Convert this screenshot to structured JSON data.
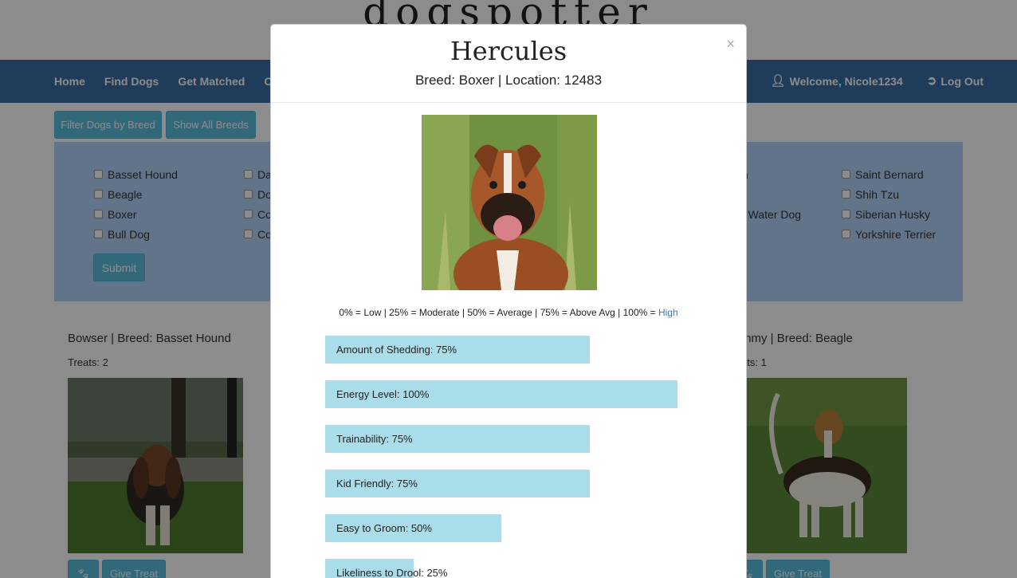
{
  "site": {
    "logo": "dogspotter"
  },
  "nav": {
    "left": [
      "Home",
      "Find Dogs",
      "Get Matched",
      "C"
    ],
    "welcome": "Welcome, Nicole1234",
    "logout": "Log Out"
  },
  "filter": {
    "filter_button": "Filter Dogs by Breed",
    "show_all_button": "Show All Breeds",
    "submit": "Submit",
    "col1": [
      "Basset Hound",
      "Beagle",
      "Boxer",
      "Bull Dog"
    ],
    "col2": [
      "Da",
      "Do",
      "Co",
      "Co"
    ],
    "col3": [
      "ian",
      "",
      "se Water Dog",
      ""
    ],
    "col4": [
      "Saint Bernard",
      "Shih Tzu",
      "Siberian Husky",
      "Yorkshire Terrier"
    ]
  },
  "dogs": [
    {
      "title": "Bowser | Breed: Basset Hound",
      "treats": "Treats: 2",
      "give_treat": "Give Treat"
    },
    {
      "title": "mmy | Breed: Beagle",
      "treats": "ats: 1",
      "give_treat": "Give Treat"
    }
  ],
  "modal": {
    "title": "Hercules",
    "subtitle": "Breed: Boxer | Location: 12483",
    "close": "×",
    "legend_main": "0% = Low | 25% = Moderate | 50% = Average | 75% = Above Avg | 100% = ",
    "legend_high": "High",
    "traits": [
      {
        "label": "Amount of Shedding: 75%",
        "value": 75
      },
      {
        "label": "Energy Level: 100%",
        "value": 100
      },
      {
        "label": "Trainability: 75%",
        "value": 75
      },
      {
        "label": "Kid Friendly: 75%",
        "value": 75
      },
      {
        "label": "Easy to Groom: 50%",
        "value": 50
      },
      {
        "label": "Likeliness to Drool: 25%",
        "value": 25
      }
    ]
  },
  "colors": {
    "nav": "#3a6ea5",
    "accent": "#5bc0de",
    "bar": "#a8dde9",
    "panel": "#b3d4fc"
  }
}
